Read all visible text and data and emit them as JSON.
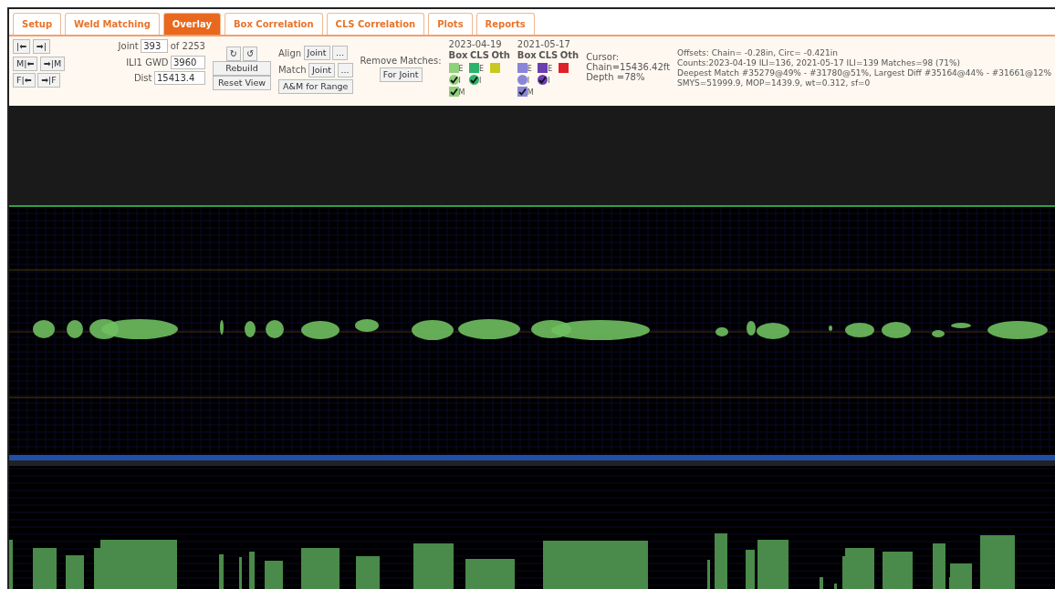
{
  "tabs": [
    {
      "label": "Setup",
      "selected": false
    },
    {
      "label": "Weld Matching",
      "selected": false
    },
    {
      "label": "Overlay",
      "selected": true
    },
    {
      "label": "Box Correlation",
      "selected": false
    },
    {
      "label": "CLS Correlation",
      "selected": false
    },
    {
      "label": "Plots",
      "selected": false
    },
    {
      "label": "Reports",
      "selected": false
    }
  ],
  "nav_buttons": [
    [
      "|⬅",
      "➡|"
    ],
    [
      "M|⬅",
      "➡|M"
    ],
    [
      "F|⬅",
      "➡|F"
    ]
  ],
  "joint": {
    "label": "Joint",
    "value": "393",
    "of": "of 2253"
  },
  "gwd": {
    "label": "ILI1 GWD",
    "value": "3960"
  },
  "dist": {
    "label": "Dist",
    "value": "15413.4"
  },
  "rotate_buttons": [
    "↻",
    "↺"
  ],
  "view_buttons": [
    "Rebuild",
    "Reset View"
  ],
  "align": {
    "label": "Align",
    "value": "Joint",
    "more": "..."
  },
  "match": {
    "label": "Match",
    "value": "Joint",
    "more": "..."
  },
  "range_button": "A&M for Range",
  "remove_matches": {
    "label": "Remove Matches:",
    "button": "For Joint"
  },
  "legends": [
    {
      "date": "2023-04-19",
      "headers": [
        "Box",
        "CLS",
        "Oth"
      ],
      "rows": [
        [
          {
            "kind": "square",
            "color": "#8fd17a",
            "checked": false,
            "label": "E"
          },
          {
            "kind": "square",
            "color": "#2db36b",
            "checked": false,
            "label": "E"
          },
          {
            "kind": "square",
            "color": "#c8c820",
            "checked": false
          }
        ],
        [
          {
            "kind": "circle",
            "color": "#8fd17a",
            "checked": true,
            "label": "I"
          },
          {
            "kind": "circle",
            "color": "#2db36b",
            "checked": true,
            "label": "I"
          }
        ],
        [
          {
            "kind": "square",
            "color": "#8fd17a",
            "checked": true,
            "label": "M"
          }
        ]
      ]
    },
    {
      "date": "2021-05-17",
      "headers": [
        "Box",
        "CLS",
        "Oth"
      ],
      "rows": [
        [
          {
            "kind": "square",
            "color": "#8a86d8",
            "checked": false,
            "label": "E"
          },
          {
            "kind": "square",
            "color": "#6a3fb0",
            "checked": false,
            "label": "E"
          },
          {
            "kind": "square",
            "color": "#e0202a",
            "checked": false
          }
        ],
        [
          {
            "kind": "circle",
            "color": "#8a86d8",
            "checked": false,
            "label": "I"
          },
          {
            "kind": "circle",
            "color": "#6a3fb0",
            "checked": true,
            "label": "I"
          }
        ],
        [
          {
            "kind": "square",
            "color": "#8a86d8",
            "checked": true,
            "label": "M"
          }
        ]
      ]
    }
  ],
  "cursor": [
    "Cursor:",
    "Chain=15436.42ft",
    "Depth =78%"
  ],
  "info": [
    "Offsets: Chain= -0.28in, Circ= -0.421in",
    "Counts:2023-04-19 ILI=136, 2021-05-17 ILI=139 Matches=98 (71%)",
    "Deepest Match #35279@49% - #31780@51%, Largest Diff #35164@44% - #31661@12%",
    "SMYS=51999.9, MOP=1439.9, wt=0.312, sf=0"
  ]
}
